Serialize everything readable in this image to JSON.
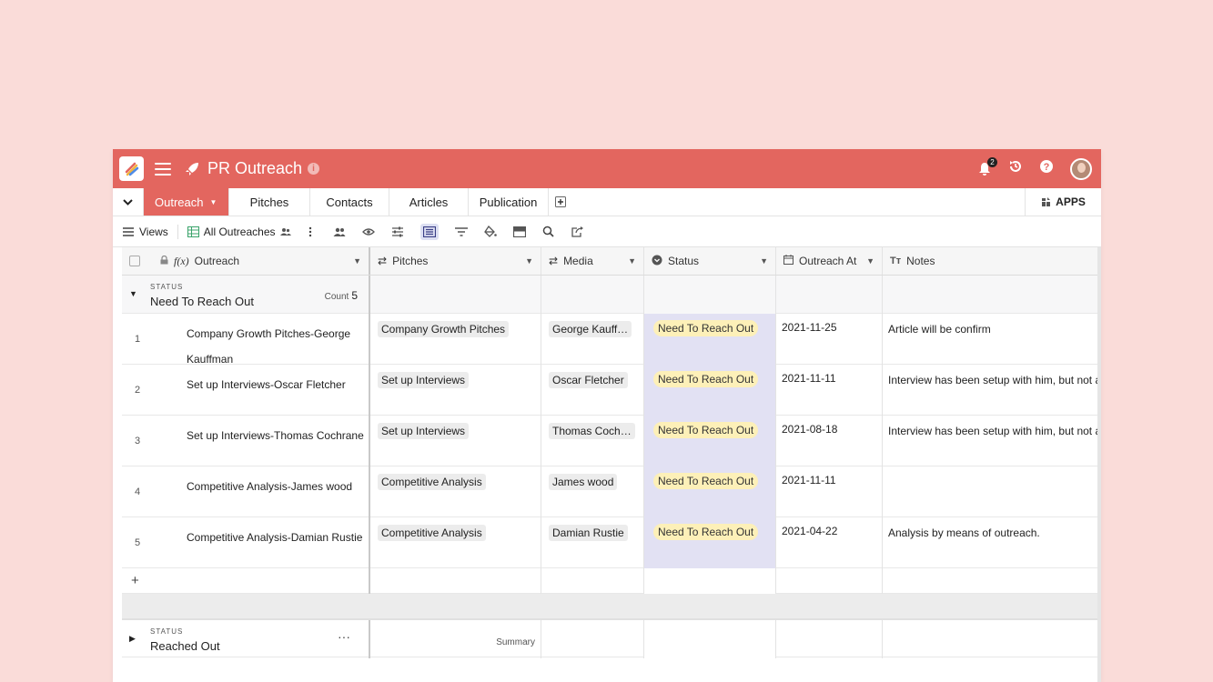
{
  "header": {
    "title": "PR Outreach",
    "notification_count": "2",
    "colors": {
      "brand": "#e3665f"
    },
    "icons": [
      "app-logo-icon",
      "menu-icon",
      "rocket-icon",
      "info-icon",
      "bell-icon",
      "history-icon",
      "help-icon",
      "avatar"
    ]
  },
  "tabs": {
    "items": [
      "Outreach",
      "Pitches",
      "Contacts",
      "Articles",
      "Publication"
    ],
    "active": "Outreach",
    "apps_label": "APPS"
  },
  "toolbar": {
    "views_label": "Views",
    "view_name": "All Outreaches"
  },
  "columns": [
    "Outreach",
    "Pitches",
    "Media",
    "Status",
    "Outreach At",
    "Notes"
  ],
  "groups": [
    {
      "label": "STATUS",
      "name": "Need To Reach Out",
      "count_label": "Count",
      "count": "5",
      "rows": [
        {
          "num": "1",
          "outreach": "Company Growth Pitches-George Kauffman",
          "pitch": "Company Growth Pitches",
          "media": "George Kauffman",
          "media_display": "George Kauff…",
          "status": "Need To Reach Out",
          "date": "2021-11-25",
          "notes": "Article will be confirm"
        },
        {
          "num": "2",
          "outreach": "Set up Interviews-Oscar Fletcher",
          "pitch": "Set up Interviews",
          "media": "Oscar Fletcher",
          "media_display": "Oscar Fletcher",
          "status": "Need To Reach Out",
          "date": "2021-11-11",
          "notes": "Interview has been setup with him, but not a"
        },
        {
          "num": "3",
          "outreach": "Set up Interviews-Thomas Cochrane",
          "pitch": "Set up Interviews",
          "media": "Thomas Cochrane",
          "media_display": "Thomas Cochr…",
          "status": "Need To Reach Out",
          "date": "2021-08-18",
          "notes": "Interview has been setup with him, but not a"
        },
        {
          "num": "4",
          "outreach": "Competitive Analysis-James wood",
          "pitch": "Competitive Analysis",
          "media": "James wood",
          "media_display": "James wood",
          "status": "Need To Reach Out",
          "date": "2021-11-11",
          "notes": ""
        },
        {
          "num": "5",
          "outreach": "Competitive Analysis-Damian Rustie",
          "pitch": "Competitive Analysis",
          "media": "Damian Rustie",
          "media_display": "Damian Rustie",
          "status": "Need To Reach Out",
          "date": "2021-04-22",
          "notes": "Analysis by means of outreach."
        }
      ],
      "add_label": "+"
    },
    {
      "label": "STATUS",
      "name": "Reached Out",
      "summary_label": "Summary"
    }
  ]
}
